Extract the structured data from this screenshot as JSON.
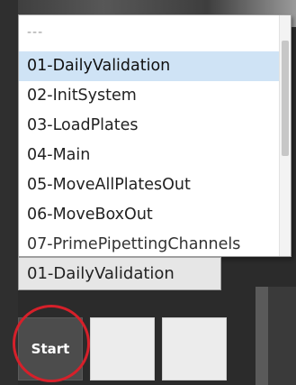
{
  "dropdown": {
    "items": [
      {
        "label": "---"
      },
      {
        "label": "01-DailyValidation",
        "selected": true
      },
      {
        "label": "02-InitSystem"
      },
      {
        "label": "03-LoadPlates"
      },
      {
        "label": "04-Main"
      },
      {
        "label": "05-MoveAllPlatesOut"
      },
      {
        "label": "06-MoveBoxOut"
      },
      {
        "label": "07-PrimePipettingChannels"
      }
    ]
  },
  "combo": {
    "value": "01-DailyValidation"
  },
  "buttons": {
    "start_label": "Start"
  },
  "colors": {
    "selection": "#cfe3f5",
    "highlight_circle": "#d6202a"
  }
}
